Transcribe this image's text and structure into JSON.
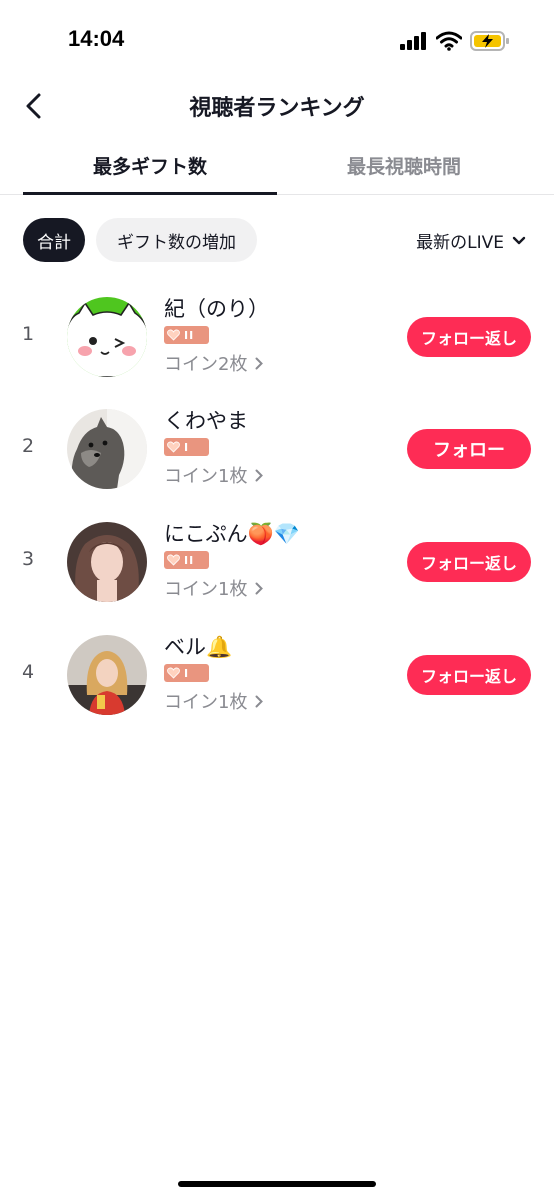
{
  "status_bar": {
    "time": "14:04"
  },
  "header": {
    "title": "視聴者ランキング"
  },
  "tabs": [
    {
      "label": "最多ギフト数",
      "active": true
    },
    {
      "label": "最長視聴時間",
      "active": false
    }
  ],
  "filters": {
    "chips": [
      {
        "label": "合計",
        "active": true
      },
      {
        "label": "ギフト数の増加",
        "active": false
      }
    ],
    "sort_label": "最新のLIVE"
  },
  "viewers": [
    {
      "rank": "1",
      "name": "紀（のり）",
      "badge": "II",
      "coins": "コイン2枚",
      "button": "フォロー返し",
      "avatar": "cat-avatar"
    },
    {
      "rank": "2",
      "name": "くわやま",
      "badge": "I",
      "coins": "コイン1枚",
      "button": "フォロー",
      "avatar": "dog-avatar"
    },
    {
      "rank": "3",
      "name": "にこぷん🍑💎",
      "badge": "II",
      "coins": "コイン1枚",
      "button": "フォロー返し",
      "avatar": "girl-avatar"
    },
    {
      "rank": "4",
      "name": "ベル🔔",
      "badge": "I",
      "coins": "コイン1枚",
      "button": "フォロー返し",
      "avatar": "person-avatar"
    }
  ],
  "colors": {
    "accent": "#fe2c55",
    "badge": "#e9957f",
    "text": "#161823",
    "muted": "#8a8b91"
  }
}
